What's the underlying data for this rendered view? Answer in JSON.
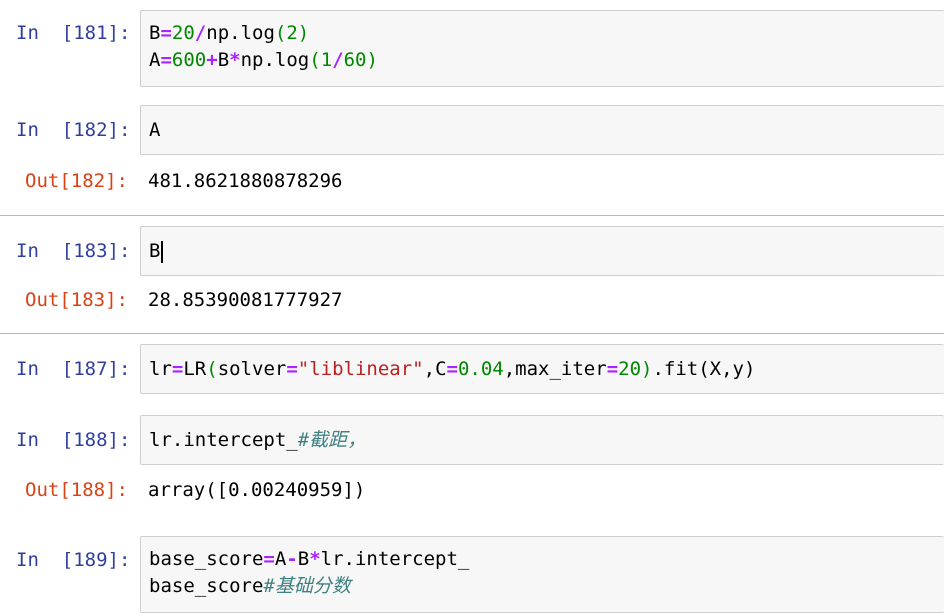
{
  "cells": [
    {
      "in_prompt": "In  [181]:",
      "lines": [
        [
          {
            "t": "B",
            "c": ""
          },
          {
            "t": "=",
            "c": "op"
          },
          {
            "t": "20",
            "c": "num"
          },
          {
            "t": "/",
            "c": "op"
          },
          {
            "t": "np.log",
            "c": ""
          },
          {
            "t": "(",
            "c": "paren"
          },
          {
            "t": "2",
            "c": "num"
          },
          {
            "t": ")",
            "c": "paren"
          }
        ],
        [
          {
            "t": "A",
            "c": ""
          },
          {
            "t": "=",
            "c": "op"
          },
          {
            "t": "600",
            "c": "num"
          },
          {
            "t": "+",
            "c": "op"
          },
          {
            "t": "B",
            "c": ""
          },
          {
            "t": "*",
            "c": "op"
          },
          {
            "t": "np.log",
            "c": ""
          },
          {
            "t": "(",
            "c": "paren"
          },
          {
            "t": "1",
            "c": "num"
          },
          {
            "t": "/",
            "c": "op"
          },
          {
            "t": "60",
            "c": "num"
          },
          {
            "t": ")",
            "c": "paren"
          }
        ]
      ]
    },
    {
      "in_prompt": "In  [182]:",
      "lines": [
        [
          {
            "t": "A",
            "c": ""
          }
        ]
      ],
      "out_prompt": "Out[182]:",
      "output": "481.8621880878296"
    },
    {
      "in_prompt": "In  [183]:",
      "lines": [
        [
          {
            "t": "B",
            "c": ""
          }
        ]
      ],
      "out_prompt": "Out[183]:",
      "output": "28.85390081777927"
    },
    {
      "in_prompt": "In  [187]:",
      "lines": [
        [
          {
            "t": "lr",
            "c": ""
          },
          {
            "t": "=",
            "c": "op"
          },
          {
            "t": "LR",
            "c": ""
          },
          {
            "t": "(",
            "c": "paren"
          },
          {
            "t": "solver",
            "c": ""
          },
          {
            "t": "=",
            "c": "op"
          },
          {
            "t": "\"liblinear\"",
            "c": "str"
          },
          {
            "t": ",C",
            "c": ""
          },
          {
            "t": "=",
            "c": "op"
          },
          {
            "t": "0.04",
            "c": "num"
          },
          {
            "t": ",max_iter",
            "c": ""
          },
          {
            "t": "=",
            "c": "op"
          },
          {
            "t": "20",
            "c": "num"
          },
          {
            "t": ")",
            "c": "paren"
          },
          {
            "t": ".fit(X,y)",
            "c": ""
          }
        ]
      ]
    },
    {
      "in_prompt": "In  [188]:",
      "lines": [
        [
          {
            "t": "lr.intercept_",
            "c": ""
          },
          {
            "t": "#截距，",
            "c": "cmt"
          }
        ]
      ],
      "out_prompt": "Out[188]:",
      "output": "array([0.00240959])"
    },
    {
      "in_prompt": "In  [189]:",
      "lines": [
        [
          {
            "t": "base_score",
            "c": ""
          },
          {
            "t": "=",
            "c": "op"
          },
          {
            "t": "A",
            "c": ""
          },
          {
            "t": "-",
            "c": "op"
          },
          {
            "t": "B",
            "c": ""
          },
          {
            "t": "*",
            "c": "op"
          },
          {
            "t": "lr.intercept_",
            "c": ""
          }
        ],
        [
          {
            "t": "base_score",
            "c": ""
          },
          {
            "t": "#基础分数",
            "c": "cmt"
          }
        ]
      ]
    }
  ]
}
